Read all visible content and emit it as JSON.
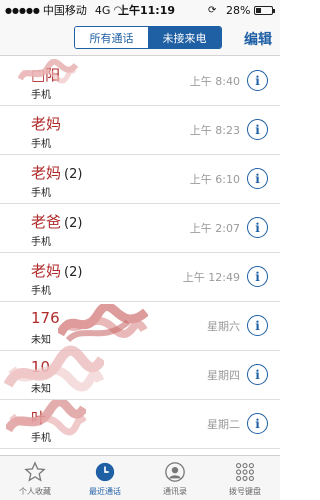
{
  "status_bar": {
    "carrier": "中国移动",
    "network": "4G",
    "time": "上午11:19",
    "battery_percent": "28%",
    "battery_level": 0.28
  },
  "nav": {
    "segments": [
      "所有通话",
      "未接来电"
    ],
    "selected_segment": "未接来电",
    "edit_label": "编辑"
  },
  "calls": [
    {
      "name": "□阳",
      "count": "",
      "type": "手机",
      "time": "上午 8:40",
      "redacted": true
    },
    {
      "name": "老妈",
      "count": "",
      "type": "手机",
      "time": "上午 8:23",
      "redacted": false
    },
    {
      "name": "老妈",
      "count": "(2)",
      "type": "手机",
      "time": "上午 6:10",
      "redacted": false
    },
    {
      "name": "老爸",
      "count": "(2)",
      "type": "手机",
      "time": "上午 2:07",
      "redacted": false
    },
    {
      "name": "老妈",
      "count": "(2)",
      "type": "手机",
      "time": "上午 12:49",
      "redacted": false
    },
    {
      "name": "176",
      "count": "",
      "type": "未知",
      "time": "星期六",
      "redacted": true
    },
    {
      "name": "10",
      "count": "",
      "type": "未知",
      "time": "星期四",
      "redacted": true
    },
    {
      "name": "叶",
      "count": "",
      "type": "手机",
      "time": "星期二",
      "redacted": true
    }
  ],
  "tabs": [
    {
      "label": "个人收藏",
      "icon": "star-icon"
    },
    {
      "label": "最近通话",
      "icon": "clock-icon"
    },
    {
      "label": "通讯录",
      "icon": "contact-icon"
    },
    {
      "label": "拨号键盘",
      "icon": "keypad-icon"
    }
  ],
  "active_tab": "最近通话",
  "colors": {
    "accent": "#1f5fa4",
    "missed": "#b02a2a",
    "redaction": "#d98a8a"
  }
}
